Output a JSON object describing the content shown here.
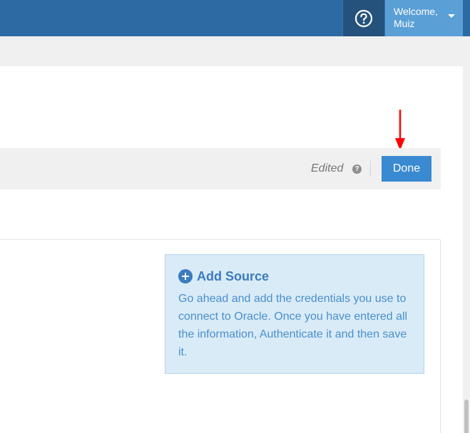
{
  "header": {
    "help_icon": "question-circle-icon",
    "welcome_line1": "Welcome,",
    "welcome_line2": "Muiz",
    "dropdown_icon": "caret-down-icon"
  },
  "actionbar": {
    "status_label": "Edited",
    "status_info_icon": "question-icon",
    "done_label": "Done"
  },
  "annotation": {
    "arrow_color": "#ff0000"
  },
  "info_panel": {
    "icon": "plus-circle-icon",
    "title": "Add Source",
    "body": "Go ahead and add the credentials you use to connect to Oracle. Once you have entered all the information, Authenticate it and then save it."
  },
  "colors": {
    "topbar": "#2d6aa3",
    "accent": "#3a8ad1",
    "info_bg": "#d9ebf7"
  }
}
